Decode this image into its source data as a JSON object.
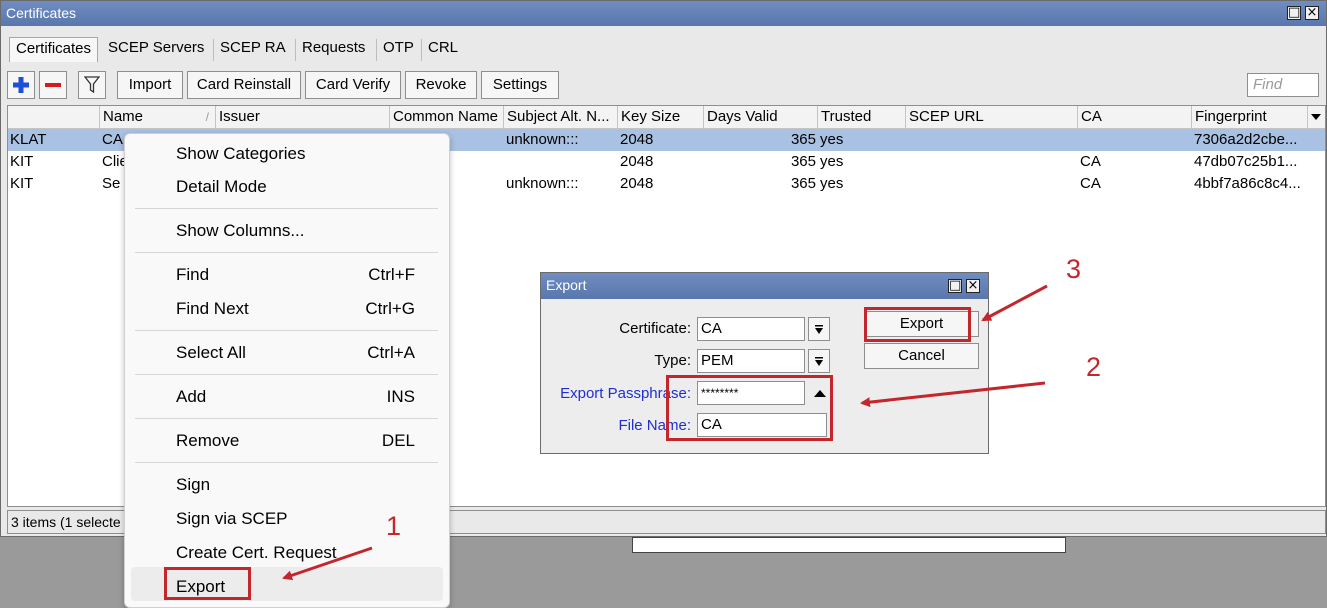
{
  "window": {
    "title": "Certificates"
  },
  "tabs": [
    "Certificates",
    "SCEP Servers",
    "SCEP RA",
    "Requests",
    "OTP",
    "CRL"
  ],
  "toolbar": {
    "add_icon": "plus-icon",
    "remove_icon": "minus-icon",
    "filter_icon": "filter-icon",
    "buttons": [
      "Import",
      "Card Reinstall",
      "Card Verify",
      "Revoke",
      "Settings"
    ],
    "find_placeholder": "Find"
  },
  "table": {
    "columns": [
      "Name",
      "Issuer",
      "Common Name",
      "Subject Alt. N...",
      "Key Size",
      "Days Valid",
      "Trusted",
      "SCEP URL",
      "CA",
      "Fingerprint"
    ],
    "rows": [
      {
        "flag": "KLAT",
        "name": "CA",
        "subject_alt": "unknown:::",
        "key_size": "2048",
        "days_valid": "365",
        "trusted": "yes",
        "ca": "",
        "fingerprint": "7306a2d2cbe...",
        "selected": true
      },
      {
        "flag": "KIT",
        "name": "Clie",
        "subject_alt": "",
        "key_size": "2048",
        "days_valid": "365",
        "trusted": "yes",
        "ca": "CA",
        "fingerprint": "47db07c25b1...",
        "selected": false
      },
      {
        "flag": "KIT",
        "name": "Se",
        "subject_alt": "unknown:::",
        "key_size": "2048",
        "days_valid": "365",
        "trusted": "yes",
        "ca": "CA",
        "fingerprint": "4bbf7a86c8c4...",
        "selected": false
      }
    ]
  },
  "status": "3 items (1 selecte",
  "context_menu": {
    "items": [
      {
        "label": "Show Categories",
        "shortcut": ""
      },
      {
        "label": "Detail Mode",
        "shortcut": ""
      },
      {
        "label": "Show Columns...",
        "shortcut": ""
      },
      {
        "label": "Find",
        "shortcut": "Ctrl+F"
      },
      {
        "label": "Find Next",
        "shortcut": "Ctrl+G"
      },
      {
        "label": "Select All",
        "shortcut": "Ctrl+A"
      },
      {
        "label": "Add",
        "shortcut": "INS"
      },
      {
        "label": "Remove",
        "shortcut": "DEL"
      },
      {
        "label": "Sign",
        "shortcut": ""
      },
      {
        "label": "Sign via SCEP",
        "shortcut": ""
      },
      {
        "label": "Create Cert. Request",
        "shortcut": ""
      },
      {
        "label": "Export",
        "shortcut": ""
      }
    ]
  },
  "export_dialog": {
    "title": "Export",
    "certificate_label": "Certificate:",
    "certificate_value": "CA",
    "type_label": "Type:",
    "type_value": "PEM",
    "passphrase_label": "Export Passphrase:",
    "passphrase_value": "********",
    "filename_label": "File Name:",
    "filename_value": "CA",
    "export_button": "Export",
    "cancel_button": "Cancel"
  },
  "annotations": {
    "step1": "1",
    "step2": "2",
    "step3": "3"
  },
  "colors": {
    "title_bar": "#5f7cb3",
    "selected_row": "#a9c1e2",
    "annotation_red": "#c4262e",
    "add_blue": "#1f4fd6",
    "remove_red": "#d21c1c"
  }
}
